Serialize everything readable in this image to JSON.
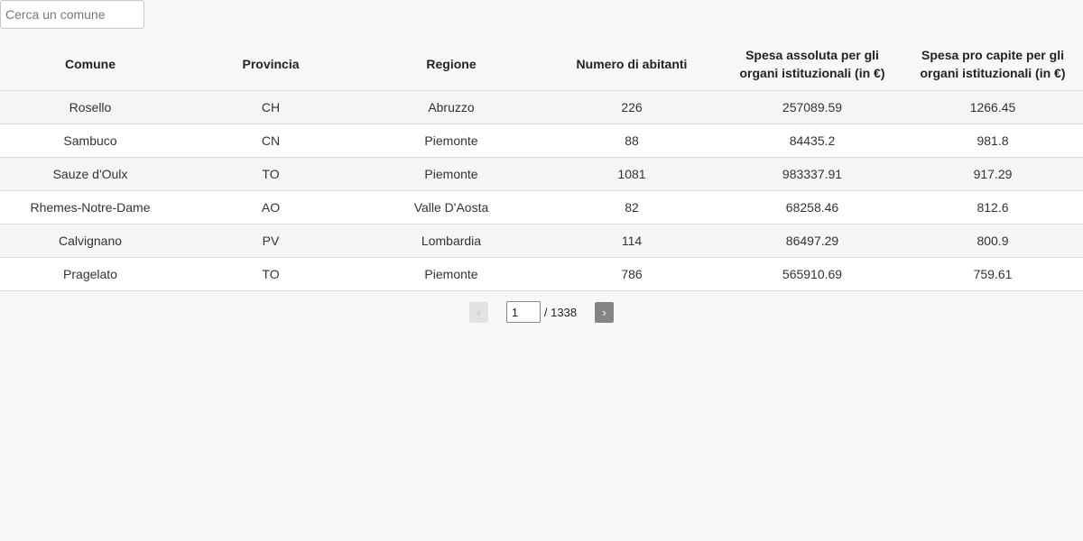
{
  "search": {
    "placeholder": "Cerca un comune",
    "value": ""
  },
  "table": {
    "headers": {
      "comune": "Comune",
      "provincia": "Provincia",
      "regione": "Regione",
      "abitanti": "Numero di abitanti",
      "spesa_assoluta": "Spesa assoluta per gli organi istituzionali (in €)",
      "spesa_pro_capite": "Spesa pro capite per gli organi istituzionali (in €)"
    },
    "rows": [
      {
        "comune": "Rosello",
        "provincia": "CH",
        "regione": "Abruzzo",
        "abitanti": "226",
        "spesa_assoluta": "257089.59",
        "spesa_pro_capite": "1266.45"
      },
      {
        "comune": "Sambuco",
        "provincia": "CN",
        "regione": "Piemonte",
        "abitanti": "88",
        "spesa_assoluta": "84435.2",
        "spesa_pro_capite": "981.8"
      },
      {
        "comune": "Sauze d'Oulx",
        "provincia": "TO",
        "regione": "Piemonte",
        "abitanti": "1081",
        "spesa_assoluta": "983337.91",
        "spesa_pro_capite": "917.29"
      },
      {
        "comune": "Rhemes-Notre-Dame",
        "provincia": "AO",
        "regione": "Valle D'Aosta",
        "abitanti": "82",
        "spesa_assoluta": "68258.46",
        "spesa_pro_capite": "812.6"
      },
      {
        "comune": "Calvignano",
        "provincia": "PV",
        "regione": "Lombardia",
        "abitanti": "114",
        "spesa_assoluta": "86497.29",
        "spesa_pro_capite": "800.9"
      },
      {
        "comune": "Pragelato",
        "provincia": "TO",
        "regione": "Piemonte",
        "abitanti": "786",
        "spesa_assoluta": "565910.69",
        "spesa_pro_capite": "759.61"
      }
    ]
  },
  "pagination": {
    "prev_label": "‹",
    "next_label": "›",
    "current_page": "1",
    "total_text": "/ 1338"
  },
  "colors": {
    "background": "#f8f8f8",
    "row_alt": "#f5f5f5",
    "next_button": "#858585",
    "prev_button_disabled": "#e2e2e2"
  }
}
